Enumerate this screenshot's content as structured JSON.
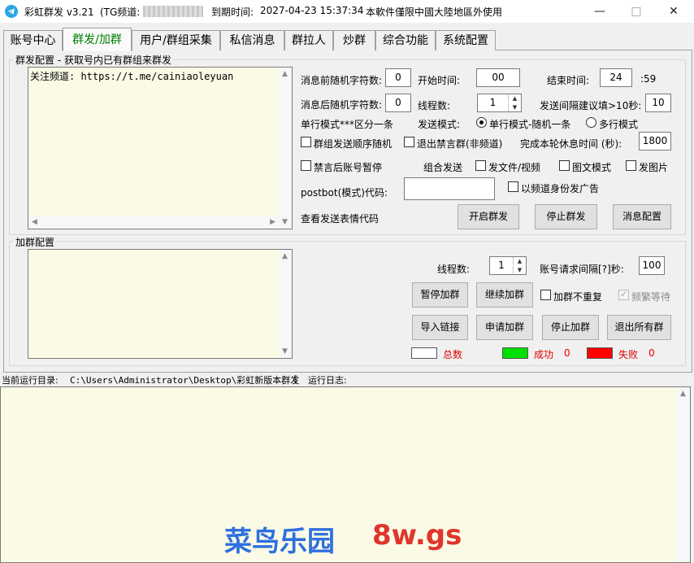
{
  "window": {
    "app_title": "彩虹群发 v3.21",
    "channel_label": "(TG频道:",
    "expiry_label": "到期时间:",
    "expiry_value": "2027-04-23 15:37:34",
    "notice": "本軟件僅限中國大陸地區外使用",
    "minimize": "—",
    "maximize": "□",
    "close": "✕"
  },
  "tabs": [
    {
      "label": "账号中心"
    },
    {
      "label": "群发/加群"
    },
    {
      "label": "用户/群组采集"
    },
    {
      "label": "私信消息"
    },
    {
      "label": "群拉人"
    },
    {
      "label": "炒群"
    },
    {
      "label": "综合功能"
    },
    {
      "label": "系统配置"
    }
  ],
  "broadcast": {
    "group_title": "群发配置 - 获取号内已有群组来群发",
    "message_text": "关注频道: https://t.me/cainiaoleyuan",
    "prefix_random_label": "消息前随机字符数:",
    "prefix_random_value": "0",
    "start_time_label": "开始时间:",
    "start_time_value": "00",
    "end_time_label": "结束时间:",
    "end_time_value": "24",
    "end_time_suffix": ":59",
    "suffix_random_label": "消息后随机字符数:",
    "suffix_random_value": "0",
    "threads_label": "线程数:",
    "threads_value": "1",
    "interval_label": "发送间隔建议填>10秒:",
    "interval_value": "10",
    "single_mode_hint": "单行模式***区分一条",
    "send_mode_label": "发送模式:",
    "mode_single": "单行模式-随机一条",
    "mode_multi": "多行模式",
    "random_order_label": "群组发送顺序随机",
    "exit_banned_label": "退出禁言群(非频道)",
    "rest_time_label": "完成本轮休息时间 (秒):",
    "rest_time_value": "1800",
    "pause_after_ban_label": "禁言后账号暂停",
    "combo_send_label": "组合发送",
    "send_file_label": "发文件/视频",
    "image_text_label": "图文模式",
    "send_image_label": "发图片",
    "postbot_label": "postbot(模式)代码:",
    "postbot_value": "",
    "channel_identity_label": "以频道身份发广告",
    "emoji_code_label": "查看发送表情代码",
    "start_button": "开启群发",
    "stop_button": "停止群发",
    "message_config_button": "消息配置"
  },
  "join": {
    "group_title": "加群配置",
    "threads_label": "线程数:",
    "threads_value": "1",
    "request_interval_label": "账号请求间隔[?]秒:",
    "request_interval_value": "100",
    "pause_button": "暂停加群",
    "continue_button": "继续加群",
    "no_repeat_label": "加群不重复",
    "frequent_wait_label": "频繁等待",
    "import_button": "导入链接",
    "request_button": "申请加群",
    "stop_button": "停止加群",
    "exit_all_button": "退出所有群",
    "total_label": "总数",
    "success_label": "成功",
    "success_count": "0",
    "fail_label": "失败",
    "fail_count": "0",
    "total_color": "#ffffff",
    "success_color": "#00e000",
    "fail_color": "#ff0000"
  },
  "status": {
    "current_dir_label": "当前运行目录:",
    "current_dir": "C:\\Users\\Administrator\\Desktop\\彩虹新版本群发",
    "separator": "|",
    "log_label": "运行日志:"
  },
  "watermark": {
    "text_cn": "菜鸟乐园",
    "text_site": "8w.gs"
  }
}
